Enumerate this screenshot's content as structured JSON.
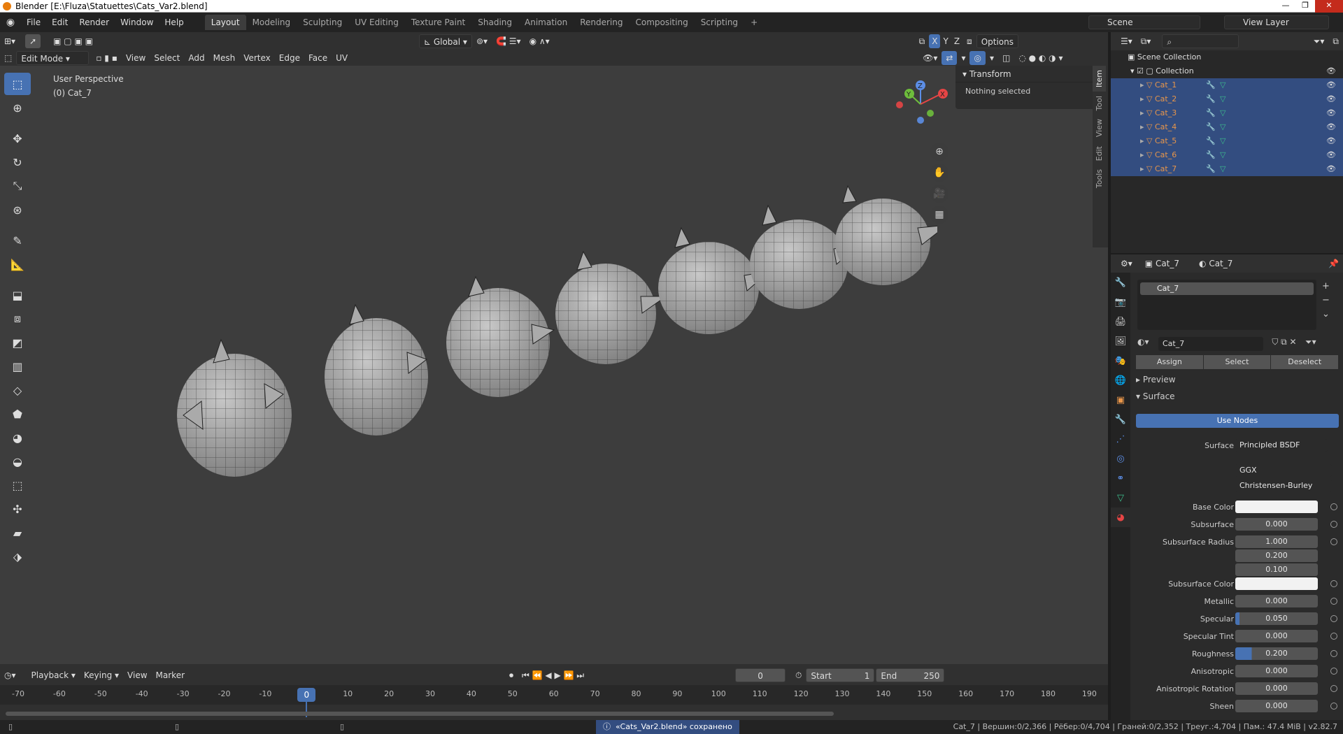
{
  "window": {
    "title": "Blender [E:\\Fluza\\Statuettes\\Cats_Var2.blend]"
  },
  "menu": [
    "File",
    "Edit",
    "Render",
    "Window",
    "Help"
  ],
  "workspaces": [
    "Layout",
    "Modeling",
    "Sculpting",
    "UV Editing",
    "Texture Paint",
    "Shading",
    "Animation",
    "Rendering",
    "Compositing",
    "Scripting"
  ],
  "active_workspace": "Layout",
  "scene": {
    "name": "Scene",
    "view_layer": "View Layer"
  },
  "viewport_header": {
    "orientation": "Global",
    "options_label": "Options",
    "axes": [
      "X",
      "Y",
      "Z"
    ],
    "mode": "Edit Mode",
    "menus": [
      "View",
      "Select",
      "Add",
      "Mesh",
      "Vertex",
      "Edge",
      "Face",
      "UV"
    ]
  },
  "viewport": {
    "perspective_label": "User Perspective",
    "object_label": "(0) Cat_7",
    "gizmo_axes": [
      "X",
      "Y",
      "Z"
    ]
  },
  "npanel": {
    "section": "Transform",
    "message": "Nothing selected",
    "tabs": [
      "Item",
      "Tool",
      "View",
      "Edit",
      "Tools"
    ]
  },
  "timeline": {
    "menus": [
      "Playback",
      "Keying",
      "View",
      "Marker"
    ],
    "current_frame": "0",
    "start_label": "Start",
    "start": "1",
    "end_label": "End",
    "end": "250",
    "ticks": [
      "-70",
      "-60",
      "-50",
      "-40",
      "-30",
      "-20",
      "-10",
      "0",
      "10",
      "20",
      "30",
      "40",
      "50",
      "60",
      "70",
      "80",
      "90",
      "100",
      "110",
      "120",
      "130",
      "140",
      "150",
      "160",
      "170",
      "180",
      "190"
    ]
  },
  "status": {
    "message": "«Cats_Var2.blend» сохранено",
    "stats": "Cat_7 | Вершин:0/2,366 | Рёбер:0/4,704 | Граней:0/2,352 | Треуг.:4,704 | Пам.: 47.4 MiB | v2.82.7"
  },
  "outliner": {
    "root": "Scene Collection",
    "collection": "Collection",
    "objects": [
      "Cat_1",
      "Cat_2",
      "Cat_3",
      "Cat_4",
      "Cat_5",
      "Cat_6",
      "Cat_7"
    ]
  },
  "properties": {
    "object_name": "Cat_7",
    "material_name": "Cat_7",
    "slot_name": "Cat_7",
    "slot_buttons": [
      "Assign",
      "Select",
      "Deselect"
    ],
    "preview_label": "Preview",
    "surface_label": "Surface",
    "use_nodes_label": "Use Nodes",
    "surface_shader_label": "Surface",
    "surface_shader": "Principled BSDF",
    "distribution": "GGX",
    "subsurface_method": "Christensen-Burley",
    "fields": [
      {
        "label": "Base Color",
        "value": "",
        "type": "color",
        "color": "#f2f2f2"
      },
      {
        "label": "Subsurface",
        "value": "0.000"
      },
      {
        "label": "Subsurface Radius",
        "value": "1.000"
      },
      {
        "label": "",
        "value": "0.200"
      },
      {
        "label": "",
        "value": "0.100"
      },
      {
        "label": "Subsurface Color",
        "value": "",
        "type": "color",
        "color": "#f2f2f2"
      },
      {
        "label": "Metallic",
        "value": "0.000"
      },
      {
        "label": "Specular",
        "value": "0.050"
      },
      {
        "label": "Specular Tint",
        "value": "0.000"
      },
      {
        "label": "Roughness",
        "value": "0.200"
      },
      {
        "label": "Anisotropic",
        "value": "0.000"
      },
      {
        "label": "Anisotropic Rotation",
        "value": "0.000"
      },
      {
        "label": "Sheen",
        "value": "0.000"
      }
    ]
  },
  "colors": {
    "accent": "#4772b3",
    "selected_row": "#334d80",
    "object_text": "#e8964a"
  }
}
